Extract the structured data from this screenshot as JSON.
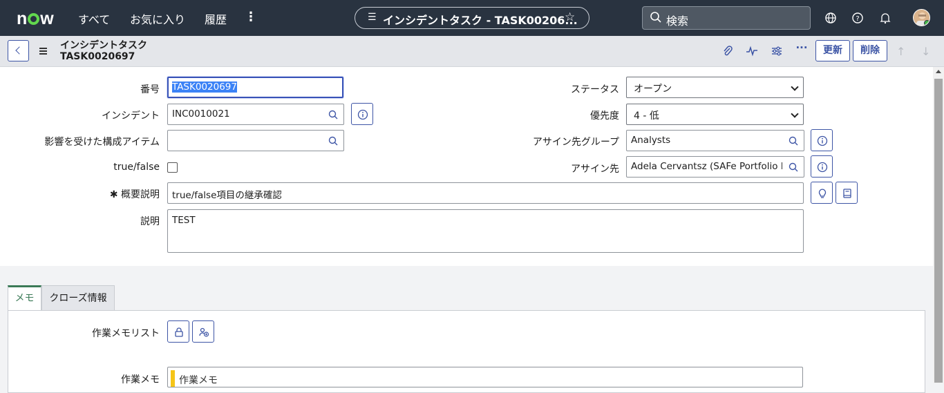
{
  "header": {
    "logo": "now",
    "nav": [
      "すべて",
      "お気に入り",
      "履歴"
    ],
    "record_title": "インシデントタスク - TASK00206...",
    "search_placeholder": "検索"
  },
  "form_header": {
    "title": "インシデントタスク",
    "subtitle": "TASK0020697",
    "update_label": "更新",
    "delete_label": "削除"
  },
  "fields": {
    "number": {
      "label": "番号",
      "value": "TASK0020697"
    },
    "incident": {
      "label": "インシデント",
      "value": "INC0010021"
    },
    "ci": {
      "label": "影響を受けた構成アイテム",
      "value": ""
    },
    "truefalse": {
      "label": "true/false",
      "checked": false
    },
    "short_description": {
      "label": "概要説明",
      "required_mark": "✱",
      "value": "true/false項目の継承確認"
    },
    "description": {
      "label": "説明",
      "value": "TEST"
    },
    "status": {
      "label": "ステータス",
      "value": "オープン"
    },
    "priority": {
      "label": "優先度",
      "value": "4 - 低"
    },
    "assignment_group": {
      "label": "アサイン先グループ",
      "value": "Analysts"
    },
    "assigned_to": {
      "label": "アサイン先",
      "value": "Adela Cervantsz (SAFe Portfolio M"
    }
  },
  "tabs": [
    {
      "label": "メモ",
      "active": true
    },
    {
      "label": "クローズ情報",
      "active": false
    }
  ],
  "notes": {
    "work_notes_list_label": "作業メモリスト",
    "work_notes_label": "作業メモ",
    "work_notes_placeholder": "作業メモ"
  },
  "colors": {
    "topbar": "#293340",
    "accent": "#3c54a5",
    "logo_green": "#62d84e",
    "active_tab": "#3b7a57",
    "work_note_bar": "#f5c518"
  }
}
